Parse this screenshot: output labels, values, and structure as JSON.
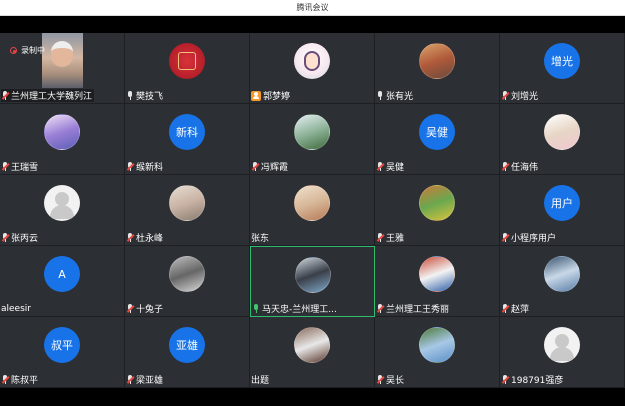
{
  "window": {
    "title": "腾讯会议"
  },
  "recording": {
    "label": "录制中"
  },
  "participants": [
    {
      "name": "兰州理工大学魏列江",
      "mic": "muted",
      "avatar": "video"
    },
    {
      "name": "樊技飞",
      "mic": "on",
      "avatar": "red"
    },
    {
      "name": "郭梦婷",
      "mic": "host",
      "avatar": "anime"
    },
    {
      "name": "张有光",
      "mic": "on",
      "avatar": "photo",
      "colors": [
        "#6b4a3c",
        "#b05a3a",
        "#d9a36a"
      ]
    },
    {
      "name": "刘增光",
      "mic": "muted",
      "avatar": "text",
      "avatar_text": "增光"
    },
    {
      "name": "王瑞雪",
      "mic": "muted",
      "avatar": "photo",
      "colors": [
        "#5b5fb8",
        "#9b7fd6",
        "#f0e3f7"
      ]
    },
    {
      "name": "缑新科",
      "mic": "muted",
      "avatar": "text",
      "avatar_text": "新科"
    },
    {
      "name": "冯辉霞",
      "mic": "muted",
      "avatar": "photo",
      "colors": [
        "#3f6b3c",
        "#8fb49a",
        "#e4eef2"
      ]
    },
    {
      "name": "吴健",
      "mic": "muted",
      "avatar": "text",
      "avatar_text": "吴健"
    },
    {
      "name": "任海伟",
      "mic": "muted",
      "avatar": "photo",
      "colors": [
        "#f1c6cf",
        "#e7d6c6",
        "#ffffff"
      ]
    },
    {
      "name": "张丙云",
      "mic": "muted",
      "avatar": "default"
    },
    {
      "name": "杜永峰",
      "mic": "muted",
      "avatar": "photo",
      "colors": [
        "#8a7d72",
        "#c9b3a4",
        "#e6dcd3"
      ]
    },
    {
      "name": "张东",
      "mic": "none",
      "avatar": "photo",
      "colors": [
        "#b87a58",
        "#d7b899",
        "#f0e0cd"
      ]
    },
    {
      "name": "王雅",
      "mic": "muted",
      "avatar": "photo",
      "colors": [
        "#d9c23d",
        "#6aa84f",
        "#c97a3a"
      ]
    },
    {
      "name": "小程序用户",
      "mic": "muted",
      "avatar": "text",
      "avatar_text": "用户"
    },
    {
      "name": "aleesir",
      "mic": "none",
      "avatar": "text",
      "avatar_text": "A"
    },
    {
      "name": "十兔子",
      "mic": "muted",
      "avatar": "photo",
      "colors": [
        "#d6d6d6",
        "#666666",
        "#bdbdbd"
      ]
    },
    {
      "name": "马天忠-兰州理工...",
      "mic": "speaking",
      "avatar": "photo",
      "colors": [
        "#7fa8c9",
        "#3a3f48",
        "#cfd8e0"
      ],
      "active": true
    },
    {
      "name": "兰州理工王秀丽",
      "mic": "muted",
      "avatar": "photo",
      "colors": [
        "#2f5ea8",
        "#f3f3f3",
        "#c94c3a"
      ]
    },
    {
      "name": "赵萍",
      "mic": "muted",
      "avatar": "photo",
      "colors": [
        "#5c7fa8",
        "#c8d8e8",
        "#3a5570"
      ]
    },
    {
      "name": "陈叔平",
      "mic": "muted",
      "avatar": "text",
      "avatar_text": "叔平"
    },
    {
      "name": "梁亚雄",
      "mic": "muted",
      "avatar": "text",
      "avatar_text": "亚雄"
    },
    {
      "name": "出题",
      "mic": "none",
      "avatar": "photo",
      "colors": [
        "#5b3a2e",
        "#e8e8e8",
        "#8a6b5c"
      ]
    },
    {
      "name": "吴长",
      "mic": "muted",
      "avatar": "photo",
      "colors": [
        "#5a8fc7",
        "#a8c8e6",
        "#4e7a3c"
      ]
    },
    {
      "name": "198791强彦",
      "mic": "muted",
      "avatar": "default"
    }
  ]
}
